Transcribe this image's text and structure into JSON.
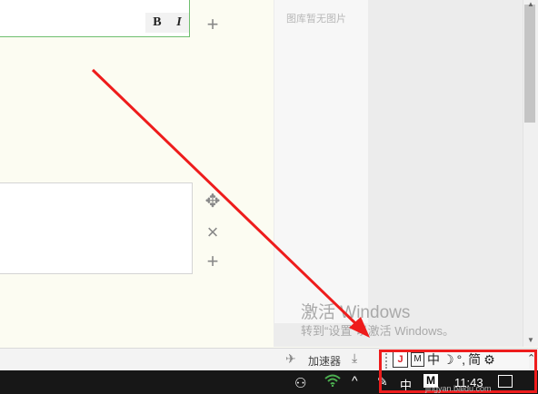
{
  "editor": {
    "bold_label": "B",
    "italic_label": "I",
    "add_icon": "+",
    "move_icon": "✥",
    "delete_icon": "×",
    "add_icon_2": "+"
  },
  "image_pane": {
    "empty_text": "图库暂无图片"
  },
  "activation": {
    "title": "激活 Windows",
    "subtitle": "转到“设置”以激活 Windows。"
  },
  "lower_bar": {
    "accelerator_label": "加速器",
    "ime": {
      "logo": "J",
      "mode_box": "M",
      "lang": "中",
      "moon": "☽",
      "punct": "°,",
      "simplified": "简",
      "settings": "⚙",
      "more": "⌃"
    }
  },
  "taskbar": {
    "people": "⚇",
    "chevron": "^",
    "pen": "✎",
    "language": "中",
    "ime_badge": "M",
    "time": "11:43"
  },
  "watermark": "jingyan.baidu.com",
  "colors": {
    "highlight": "#ee1c1c",
    "arrow": "#ee1c1c",
    "wifi": "#4caf50"
  }
}
